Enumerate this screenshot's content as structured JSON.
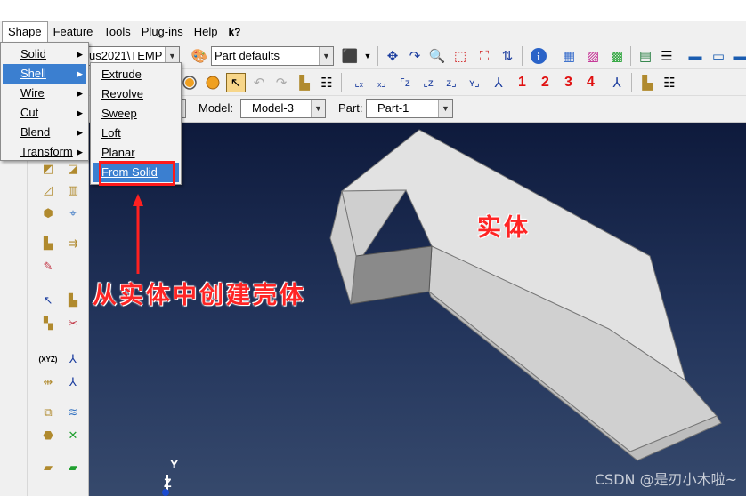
{
  "menubar": {
    "items": [
      "Shape",
      "Feature",
      "Tools",
      "Plug-ins",
      "Help",
      "k?"
    ],
    "active": "Shape"
  },
  "toolbar1": {
    "path_combo": "us2021\\TEMP",
    "render_combo": "Part defaults"
  },
  "toolbar2": {
    "numbers": [
      "1",
      "2",
      "3",
      "4"
    ]
  },
  "contextbar": {
    "model_label": "Model:",
    "model_value": "Model-3",
    "part_label": "Part:",
    "part_value": "Part-1"
  },
  "shape_menu": {
    "items": [
      "Solid",
      "Shell",
      "Wire",
      "Cut",
      "Blend",
      "Transform"
    ],
    "highlighted": "Shell"
  },
  "shell_submenu": {
    "items": [
      "Extrude",
      "Revolve",
      "Sweep",
      "Loft",
      "Planar",
      "From Solid"
    ],
    "highlighted": "From Solid"
  },
  "annotations": {
    "create_shell_text": "从实体中创建壳体",
    "solid_text": "实体"
  },
  "triad": {
    "y_label": "Y",
    "z_label": "Z"
  },
  "watermark": "CSDN @是刃小木啦~",
  "colors": {
    "highlight": "#3b7fd0",
    "annotation_red": "#ff2525",
    "viewport_bg": "#1a2a4e",
    "solid_face": "#d6d6d6"
  }
}
